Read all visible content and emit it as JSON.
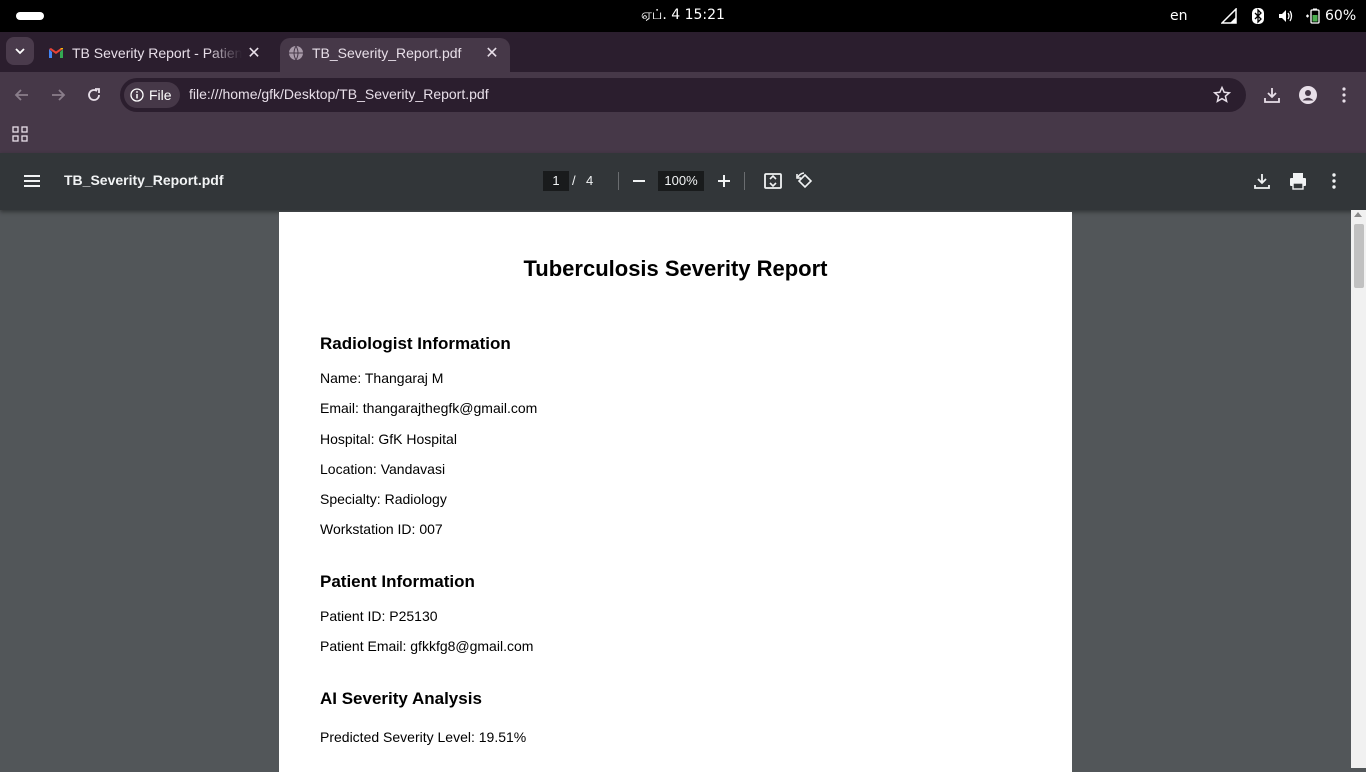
{
  "system": {
    "clock": "ஏப். 4  15:21",
    "language": "en",
    "battery": "60%"
  },
  "tabs": [
    {
      "title": "TB Severity Report - Patient",
      "icon": "gmail-icon",
      "active": false
    },
    {
      "title": "TB_Severity_Report.pdf",
      "icon": "globe-icon",
      "active": true
    }
  ],
  "toolbar": {
    "chip_label": "File",
    "url": "file:///home/gfk/Desktop/TB_Severity_Report.pdf"
  },
  "pdf_viewer": {
    "filename": "TB_Severity_Report.pdf",
    "current_page": "1",
    "separator": "/",
    "total_pages": "4",
    "zoom": "100%"
  },
  "document": {
    "title": "Tuberculosis Severity Report",
    "radiologist": {
      "heading": "Radiologist Information",
      "lines": [
        "Name: Thangaraj M",
        "Email: thangarajthegfk@gmail.com",
        "Hospital: GfK Hospital",
        "Location: Vandavasi",
        "Specialty: Radiology",
        "Workstation ID: 007"
      ]
    },
    "patient": {
      "heading": "Patient Information",
      "lines": [
        "Patient ID: P25130",
        "Patient Email: gfkkfg8@gmail.com"
      ]
    },
    "analysis": {
      "heading": "AI Severity Analysis",
      "lines": [
        "Predicted Severity Level: 19.51%"
      ]
    }
  },
  "colors": {
    "tabstrip": "#2b1e2e",
    "toolbar": "#463848",
    "pdf_toolbar": "#323639",
    "pdf_background": "#525659"
  }
}
